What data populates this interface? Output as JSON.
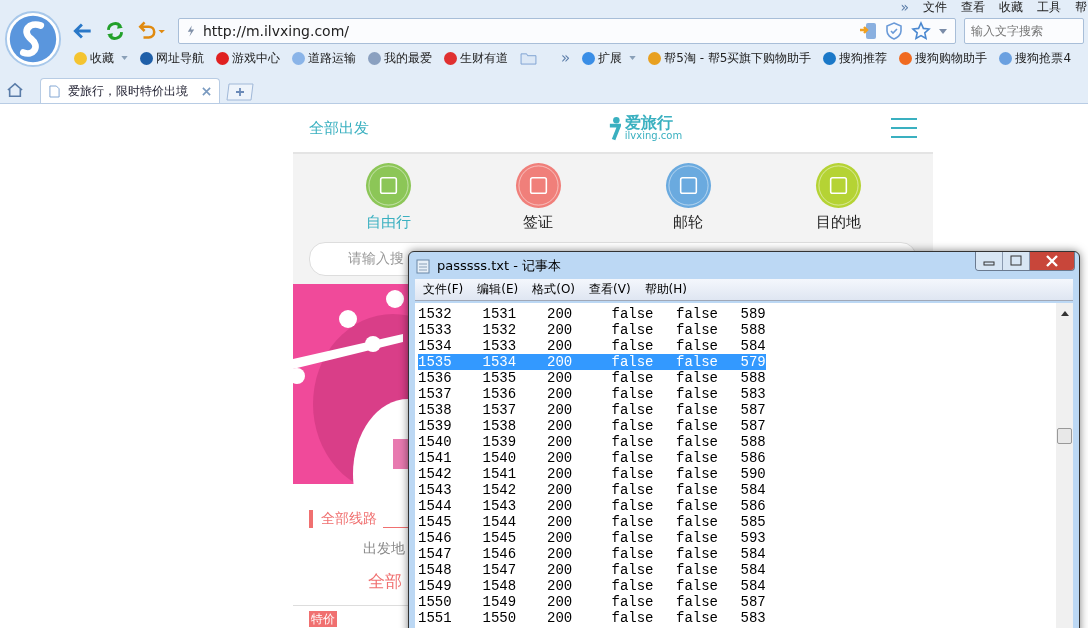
{
  "browser": {
    "menu": [
      "文件",
      "查看",
      "收藏",
      "工具",
      "帮"
    ],
    "address": "http://m.ilvxing.com/",
    "search": {
      "placeholder": "输入文字搜索"
    },
    "bookmarks": [
      {
        "label": "收藏",
        "dropdown": true
      },
      {
        "label": "网址导航",
        "dropdown": false
      },
      {
        "label": "游戏中心",
        "dropdown": false
      },
      {
        "label": "道路运输",
        "dropdown": false
      },
      {
        "label": "我的最爱",
        "dropdown": false
      },
      {
        "label": "生财有道",
        "dropdown": false
      }
    ],
    "more": "»",
    "extensions": [
      {
        "label": "扩展",
        "dropdown": true
      },
      {
        "label": "帮5淘 - 帮5买旗下购物助手",
        "dropdown": false
      },
      {
        "label": "搜狗推荐",
        "dropdown": false
      },
      {
        "label": "搜狗购物助手",
        "dropdown": false
      },
      {
        "label": "搜狗抢票4",
        "dropdown": false
      }
    ],
    "tabs": [
      {
        "title": "爱旅行，限时特价出境",
        "selected": true
      }
    ]
  },
  "page": {
    "header": {
      "left": "全部出发",
      "logo_cn": "爱旅行",
      "logo_en": "ilvxing.com"
    },
    "categories": [
      {
        "label": "自由行",
        "selected": true,
        "color": "#8cc657"
      },
      {
        "label": "签证",
        "selected": false,
        "color": "#f07f7a"
      },
      {
        "label": "邮轮",
        "selected": false,
        "color": "#6aaadf"
      },
      {
        "label": "目的地",
        "selected": false,
        "color": "#b5d334"
      }
    ],
    "search": {
      "placeholder": "请输入搜"
    },
    "section_title": "全部线路",
    "departure_label": "出发地",
    "departure_value": "全部",
    "special_tag": "特价"
  },
  "notepad": {
    "title": "passsss.txt - 记事本",
    "menu": [
      "文件(F)",
      "编辑(E)",
      "格式(O)",
      "查看(V)",
      "帮助(H)"
    ],
    "rows": [
      {
        "cells": [
          "1532",
          "1531",
          "200",
          "false",
          "false",
          "589"
        ],
        "selected": false
      },
      {
        "cells": [
          "1533",
          "1532",
          "200",
          "false",
          "false",
          "588"
        ],
        "selected": false
      },
      {
        "cells": [
          "1534",
          "1533",
          "200",
          "false",
          "false",
          "584"
        ],
        "selected": false
      },
      {
        "cells": [
          "1535",
          "1534",
          "200",
          "false",
          "false",
          "579"
        ],
        "selected": true
      },
      {
        "cells": [
          "1536",
          "1535",
          "200",
          "false",
          "false",
          "588"
        ],
        "selected": false
      },
      {
        "cells": [
          "1537",
          "1536",
          "200",
          "false",
          "false",
          "583"
        ],
        "selected": false
      },
      {
        "cells": [
          "1538",
          "1537",
          "200",
          "false",
          "false",
          "587"
        ],
        "selected": false
      },
      {
        "cells": [
          "1539",
          "1538",
          "200",
          "false",
          "false",
          "587"
        ],
        "selected": false
      },
      {
        "cells": [
          "1540",
          "1539",
          "200",
          "false",
          "false",
          "588"
        ],
        "selected": false
      },
      {
        "cells": [
          "1541",
          "1540",
          "200",
          "false",
          "false",
          "586"
        ],
        "selected": false
      },
      {
        "cells": [
          "1542",
          "1541",
          "200",
          "false",
          "false",
          "590"
        ],
        "selected": false
      },
      {
        "cells": [
          "1543",
          "1542",
          "200",
          "false",
          "false",
          "584"
        ],
        "selected": false
      },
      {
        "cells": [
          "1544",
          "1543",
          "200",
          "false",
          "false",
          "586"
        ],
        "selected": false
      },
      {
        "cells": [
          "1545",
          "1544",
          "200",
          "false",
          "false",
          "585"
        ],
        "selected": false
      },
      {
        "cells": [
          "1546",
          "1545",
          "200",
          "false",
          "false",
          "593"
        ],
        "selected": false
      },
      {
        "cells": [
          "1547",
          "1546",
          "200",
          "false",
          "false",
          "584"
        ],
        "selected": false
      },
      {
        "cells": [
          "1548",
          "1547",
          "200",
          "false",
          "false",
          "584"
        ],
        "selected": false
      },
      {
        "cells": [
          "1549",
          "1548",
          "200",
          "false",
          "false",
          "584"
        ],
        "selected": false
      },
      {
        "cells": [
          "1550",
          "1549",
          "200",
          "false",
          "false",
          "587"
        ],
        "selected": false
      },
      {
        "cells": [
          "1551",
          "1550",
          "200",
          "false",
          "false",
          "583"
        ],
        "selected": false
      }
    ]
  }
}
